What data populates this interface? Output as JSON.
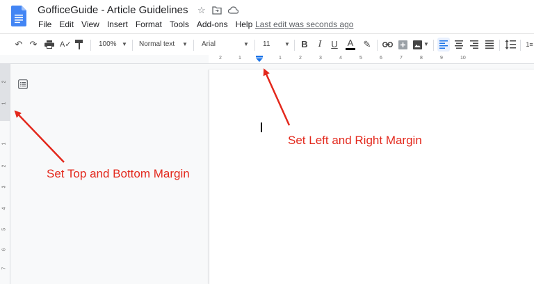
{
  "app": {
    "doc_title": "GofficeGuide - Article Guidelines",
    "last_edit": "Last edit was seconds ago"
  },
  "menu": [
    "File",
    "Edit",
    "View",
    "Insert",
    "Format",
    "Tools",
    "Add-ons",
    "Help"
  ],
  "toolbar": {
    "zoom": "100%",
    "style": "Normal text",
    "font": "Arial",
    "font_size": "11",
    "bold": "B",
    "italic": "I",
    "underline": "U",
    "text_color": "A"
  },
  "ruler": {
    "h_ticks": [
      "2",
      "1",
      "1",
      "2",
      "3",
      "4",
      "5",
      "6",
      "7",
      "8",
      "9",
      "10"
    ],
    "v_ticks": [
      "2",
      "1",
      "1",
      "2",
      "3",
      "4",
      "5",
      "6",
      "7"
    ]
  },
  "annotations": {
    "top_bottom": "Set Top and Bottom Margin",
    "left_right": "Set Left and Right Margin"
  },
  "colors": {
    "accent": "#1a73e8",
    "annotation": "#e3281c"
  }
}
